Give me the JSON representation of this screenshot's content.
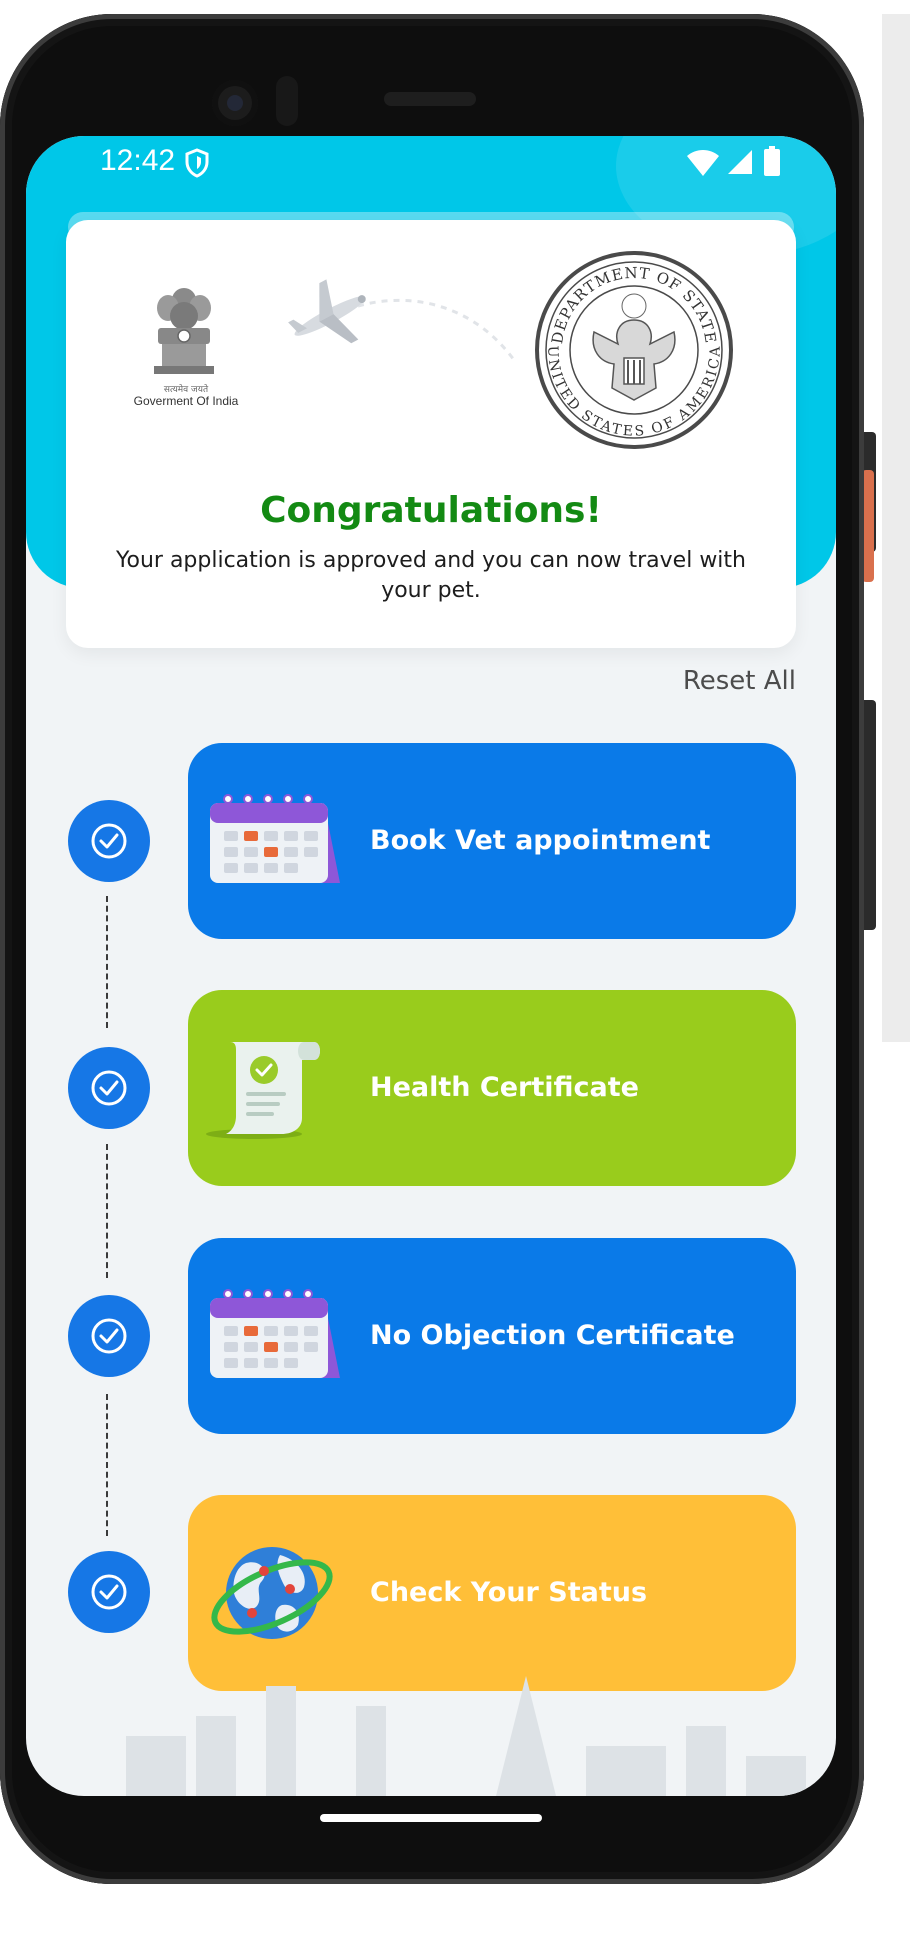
{
  "status_bar": {
    "time": "12:42"
  },
  "card": {
    "emblem_caption_hindi": "सत्यमेव जयते",
    "emblem_caption": "Goverment Of India",
    "seal_top_text": "DEPARTMENT OF STATE",
    "seal_bottom_text": "UNITED STATES OF AMERICA",
    "title": "Congratulations!",
    "message": "Your application is approved and you can now travel with your pet."
  },
  "actions": {
    "reset_label": "Reset All"
  },
  "steps": [
    {
      "label": "Book Vet appointment",
      "color": "#0a7ae8",
      "icon": "calendar-icon",
      "completed": true
    },
    {
      "label": "Health Certificate",
      "color": "#99cc1c",
      "icon": "certificate-scroll-icon",
      "completed": true
    },
    {
      "label": "No Objection Certificate",
      "color": "#0a7ae8",
      "icon": "calendar-icon",
      "completed": true
    },
    {
      "label": "Check Your Status",
      "color": "#ffbf38",
      "icon": "globe-icon",
      "completed": true
    }
  ],
  "colors": {
    "header": "#00c7e8",
    "title_green": "#138a13",
    "check_blue": "#1677e6"
  }
}
